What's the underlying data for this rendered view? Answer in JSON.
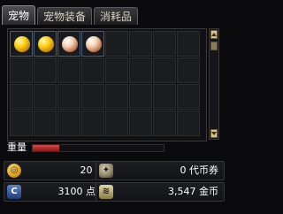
{
  "tabs": [
    {
      "label": "宠物",
      "active": true
    },
    {
      "label": "宠物装备",
      "active": false
    },
    {
      "label": "消耗品",
      "active": false
    }
  ],
  "grid": {
    "columns": 8,
    "rows": 4,
    "items": [
      {
        "slot": 0,
        "icon": "gold-orb-icon"
      },
      {
        "slot": 1,
        "icon": "gold-orb-icon"
      },
      {
        "slot": 2,
        "icon": "pearl-orb-icon"
      },
      {
        "slot": 3,
        "icon": "pearl-orb-icon"
      }
    ]
  },
  "weight": {
    "label": "重量",
    "fill_fraction": 0.2,
    "fill_color": "#b52a2a"
  },
  "currency": {
    "items_count": "20 个",
    "voucher_currency": "0 代币券",
    "points_voucher": "3100 点券",
    "gold": "3,547 金币"
  }
}
